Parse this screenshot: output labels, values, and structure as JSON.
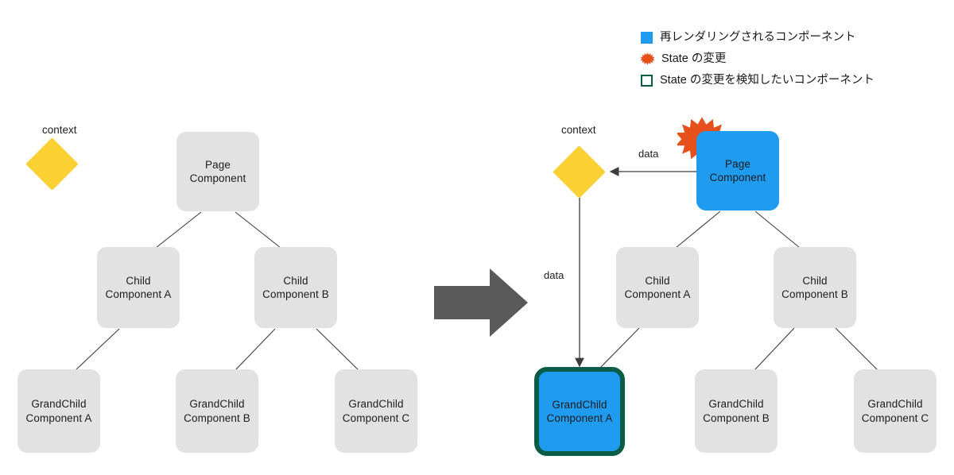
{
  "legend": {
    "items": [
      {
        "icon": "filled-square-icon",
        "color": "#219bf0",
        "text": "再レンダリングされるコンポーネント"
      },
      {
        "icon": "starburst-icon",
        "color": "#e5501b",
        "text": "State の変更"
      },
      {
        "icon": "outlined-square-icon",
        "color": "#0a5c47",
        "text": "State の変更を検知したいコンポーネント"
      }
    ]
  },
  "diagram_left": {
    "context_label": "context",
    "nodes": {
      "page": "Page\nComponent",
      "child_a": "Child\nComponent A",
      "child_b": "Child\nComponent B",
      "grandchild_a": "GrandChild\nComponent A",
      "grandchild_b": "GrandChild\nComponent B",
      "grandchild_c": "GrandChild\nComponent C"
    }
  },
  "diagram_right": {
    "context_label": "context",
    "data_label_top": "data",
    "data_label_side": "data",
    "nodes": {
      "page": "Page\nComponent",
      "child_a": "Child\nComponent A",
      "child_b": "Child\nComponent B",
      "grandchild_a": "GrandChild\nComponent A",
      "grandchild_b": "GrandChild\nComponent B",
      "grandchild_c": "GrandChild\nComponent C"
    }
  },
  "colors": {
    "node_default": "#e2e2e2",
    "node_highlight": "#219bf0",
    "node_outline": "#0a5c47",
    "context_diamond": "#fbd033",
    "state_change": "#e5501b",
    "transition_arrow": "#5a5a5a",
    "edge": "#3c3c3c"
  }
}
